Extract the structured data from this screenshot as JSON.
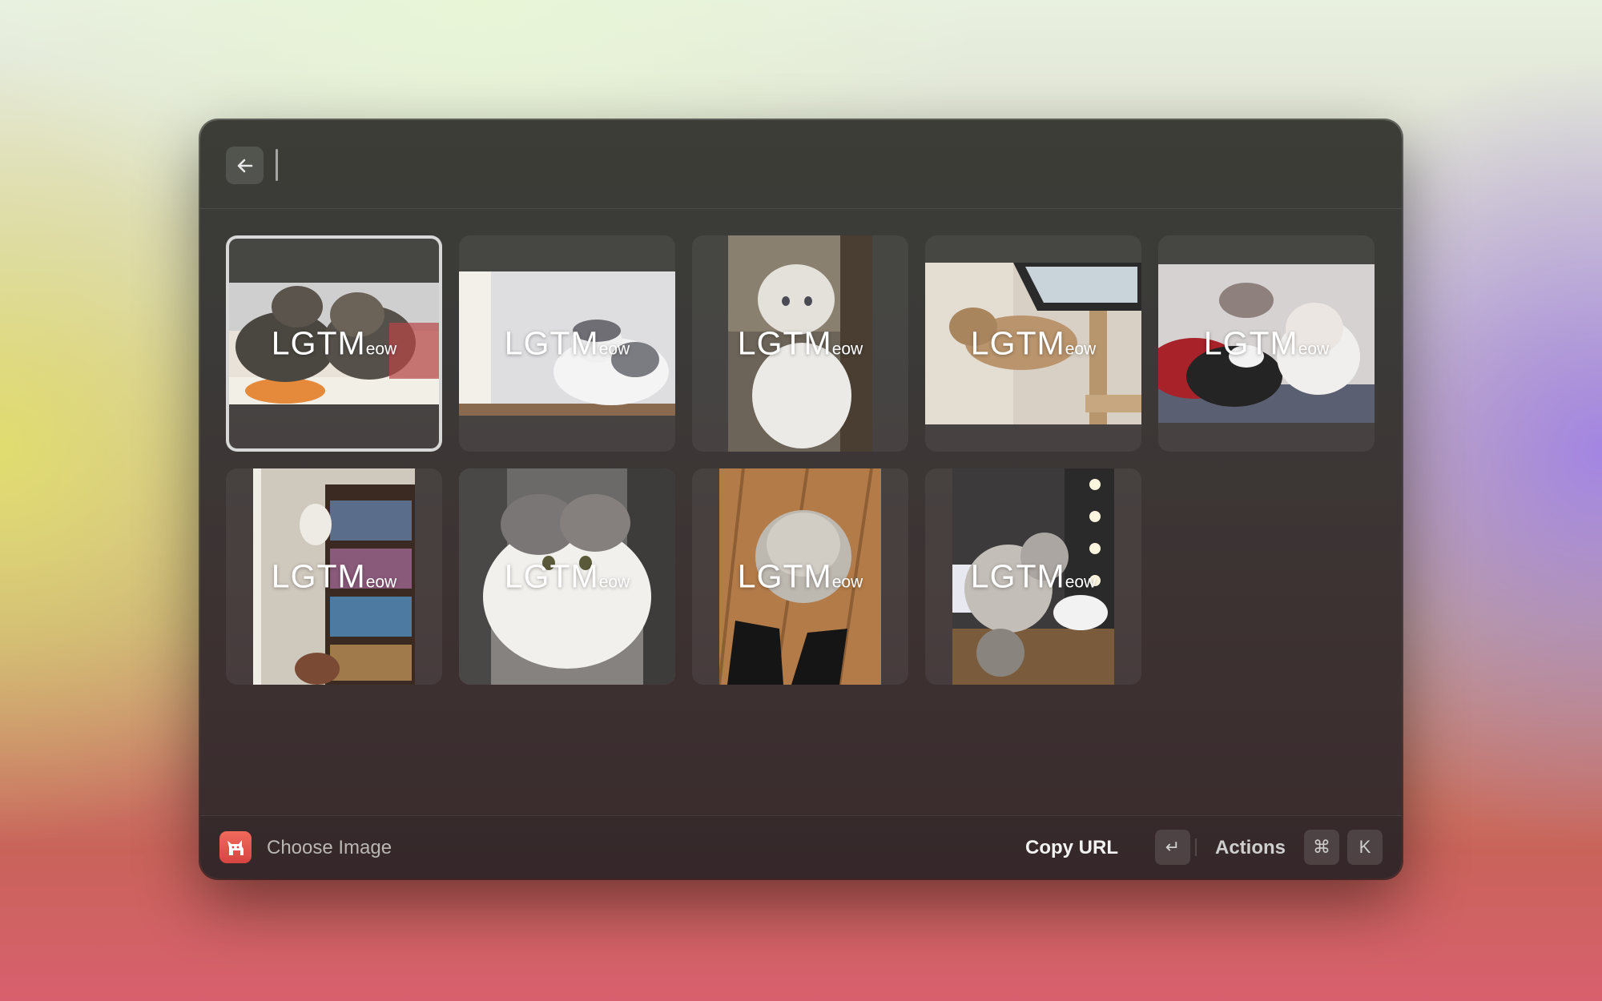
{
  "search": {
    "placeholder": "",
    "value": ""
  },
  "grid": {
    "overlay_main": "LGTM",
    "overlay_suffix": "eow",
    "images": [
      {
        "subject": "two tabby kittens in box",
        "selected": true
      },
      {
        "subject": "white and grey cat lying"
      },
      {
        "subject": "fluffy white kitten sitting"
      },
      {
        "subject": "cat on cat tree by window"
      },
      {
        "subject": "white and black kittens on red blanket"
      },
      {
        "subject": "cat on bookshelf"
      },
      {
        "subject": "white and grey cat close-up"
      },
      {
        "subject": "persian cat on wooden floor"
      },
      {
        "subject": "fluffy cats in bathroom"
      }
    ]
  },
  "footer": {
    "title": "Choose Image",
    "primary_action": "Copy URL",
    "enter_key": "↵",
    "actions_label": "Actions",
    "cmd_key": "⌘",
    "k_key": "K"
  }
}
